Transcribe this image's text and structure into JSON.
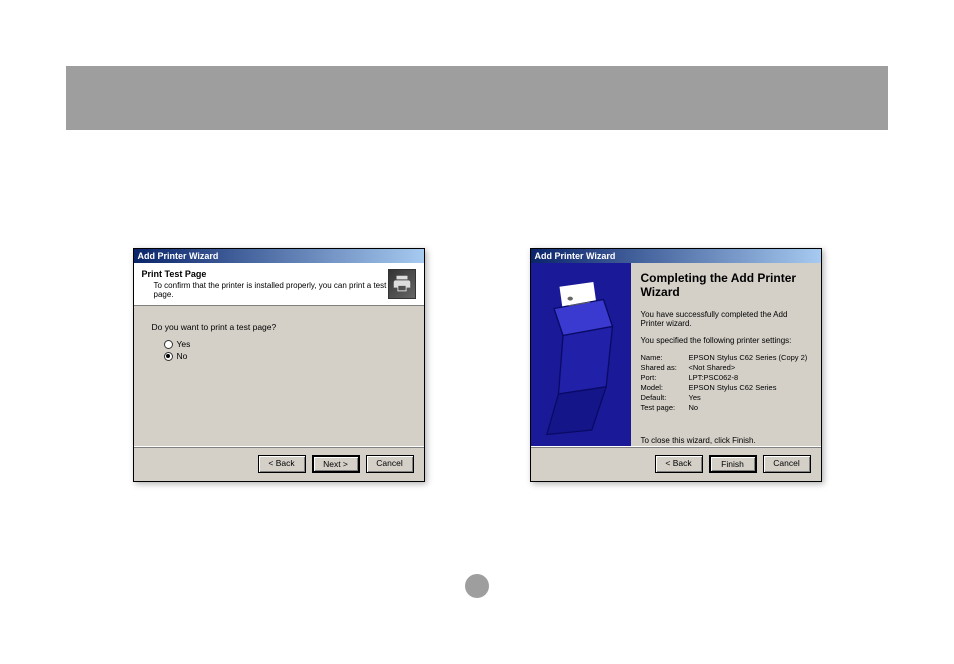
{
  "dialog_left": {
    "title": "Add Printer Wizard",
    "header_title": "Print Test Page",
    "header_sub": "To confirm that the printer is installed properly, you can print a test page.",
    "prompt": "Do you want to print a test page?",
    "opt_yes": "Yes",
    "opt_no": "No",
    "btn_back": "< Back",
    "btn_next": "Next >",
    "btn_cancel": "Cancel"
  },
  "dialog_right": {
    "title": "Add Printer Wizard",
    "heading": "Completing the Add Printer Wizard",
    "success": "You have successfully completed the Add Printer wizard.",
    "specified": "You specified the following printer settings:",
    "rows": {
      "name_l": "Name:",
      "name_v": "EPSON Stylus C62 Series (Copy 2)",
      "shared_l": "Shared as:",
      "shared_v": "<Not Shared>",
      "port_l": "Port:",
      "port_v": "LPT:PSC062-8",
      "model_l": "Model:",
      "model_v": "EPSON Stylus C62 Series",
      "default_l": "Default:",
      "default_v": "Yes",
      "test_l": "Test page:",
      "test_v": "No"
    },
    "close_text": "To close this wizard, click Finish.",
    "btn_back": "< Back",
    "btn_finish": "Finish",
    "btn_cancel": "Cancel"
  }
}
